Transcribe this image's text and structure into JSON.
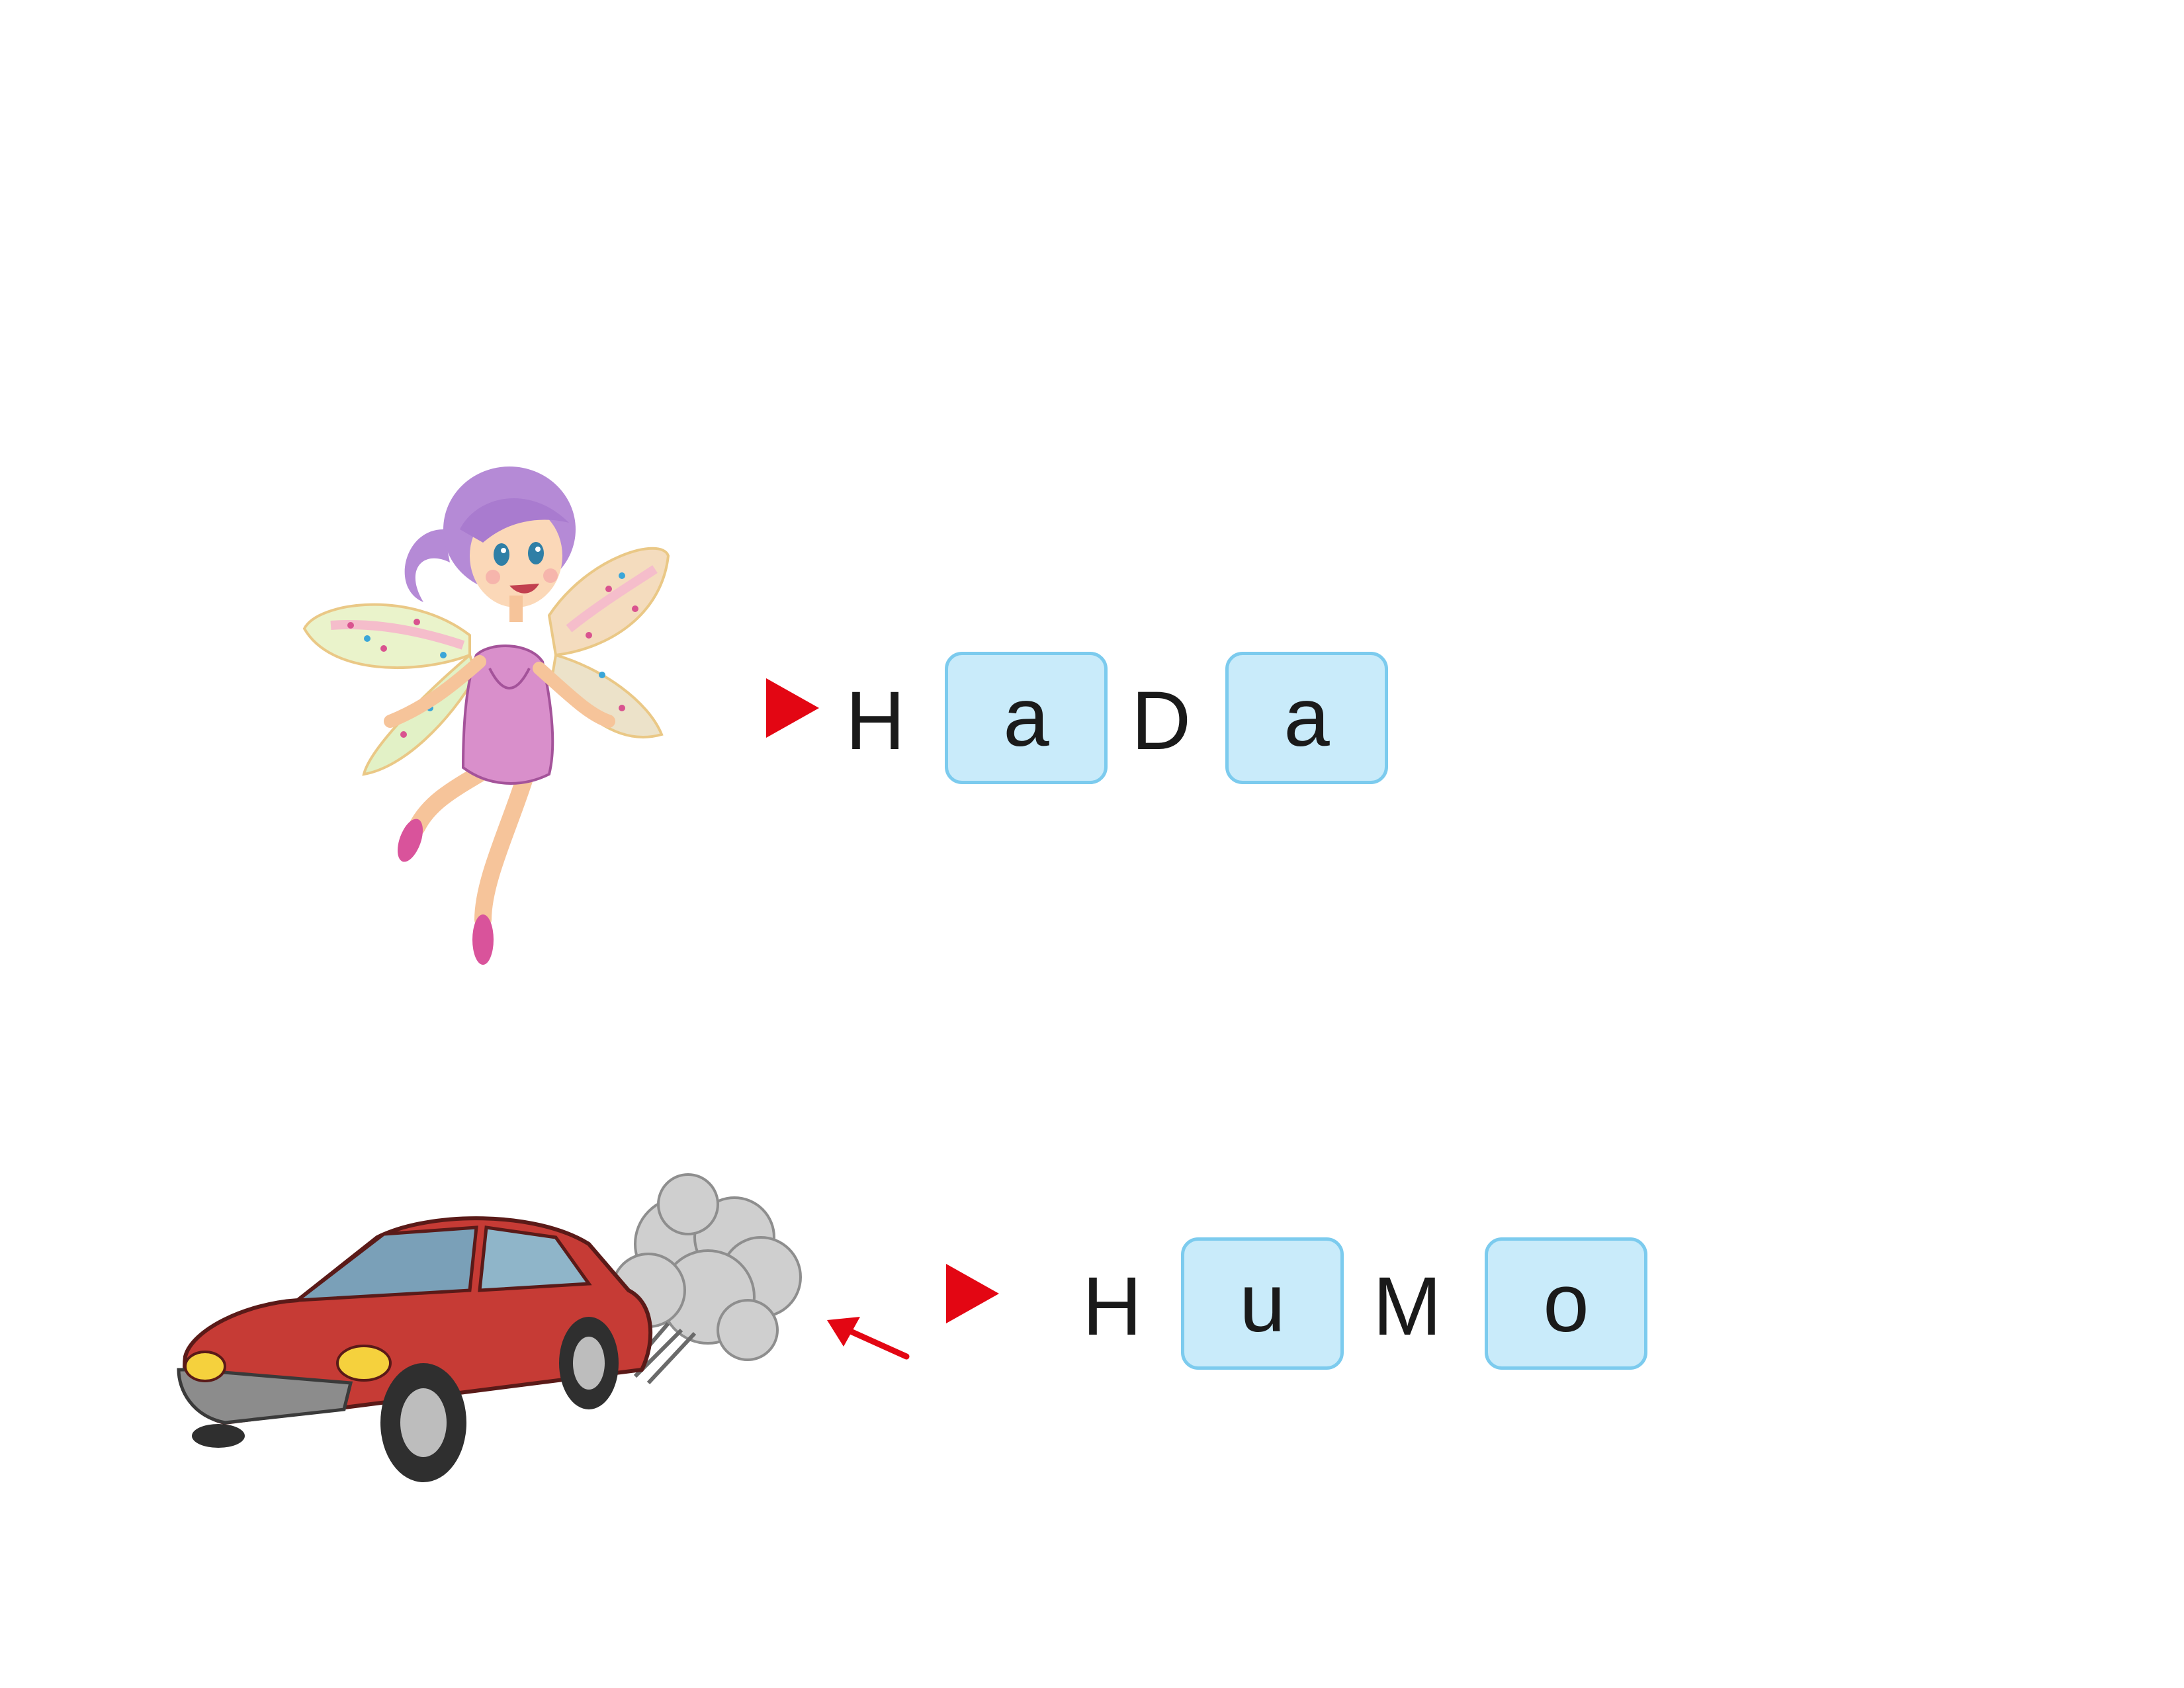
{
  "colors": {
    "marker_red": "#e30613",
    "box_fill": "#c9ebfa",
    "box_border": "#7ccbee",
    "text": "#1a1a1a"
  },
  "icons": [
    "fairy-illustration",
    "red-car-smoke-illustration",
    "play-triangle-icon",
    "red-arrow-icon"
  ],
  "words": [
    {
      "id": "hada",
      "image": "fairy-illustration",
      "letters": [
        {
          "char": "H",
          "boxed": false
        },
        {
          "char": "a",
          "boxed": true
        },
        {
          "char": "D",
          "boxed": false
        },
        {
          "char": "a",
          "boxed": true
        }
      ]
    },
    {
      "id": "humo",
      "image": "red-car-smoke-illustration",
      "letters": [
        {
          "char": "H",
          "boxed": false
        },
        {
          "char": "u",
          "boxed": true
        },
        {
          "char": "M",
          "boxed": false
        },
        {
          "char": "o",
          "boxed": true
        }
      ]
    }
  ]
}
